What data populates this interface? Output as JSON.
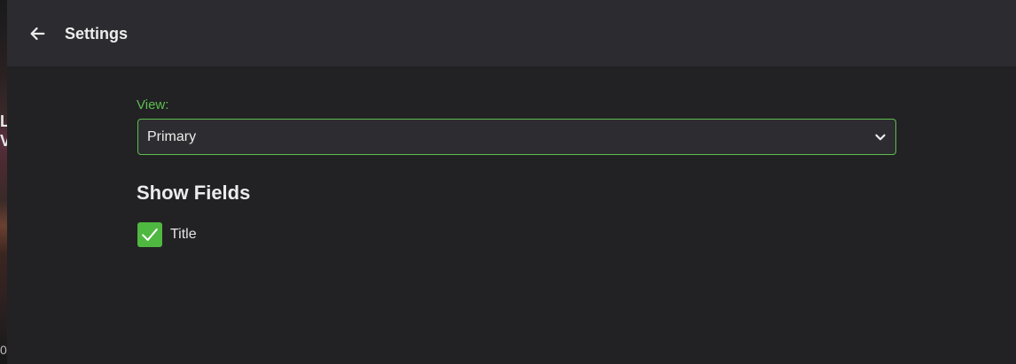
{
  "header": {
    "title": "Settings",
    "back_icon": "arrow-left-icon"
  },
  "view": {
    "label": "View:",
    "selected": "Primary",
    "chevron_icon": "chevron-down-icon"
  },
  "show_fields": {
    "title": "Show Fields",
    "fields": [
      {
        "label": "Title",
        "checked": true,
        "icon": "checkmark-icon"
      }
    ]
  },
  "background_fragment": {
    "text_1": "L",
    "text_2": "V",
    "bottom_text": "0"
  },
  "colors": {
    "accent": "#5cbf4e",
    "checkbox_fill": "#4fb840",
    "header_bg": "#2c2b2f",
    "panel_bg": "#222124",
    "select_bg": "#2d2c30",
    "text": "#ececec"
  }
}
